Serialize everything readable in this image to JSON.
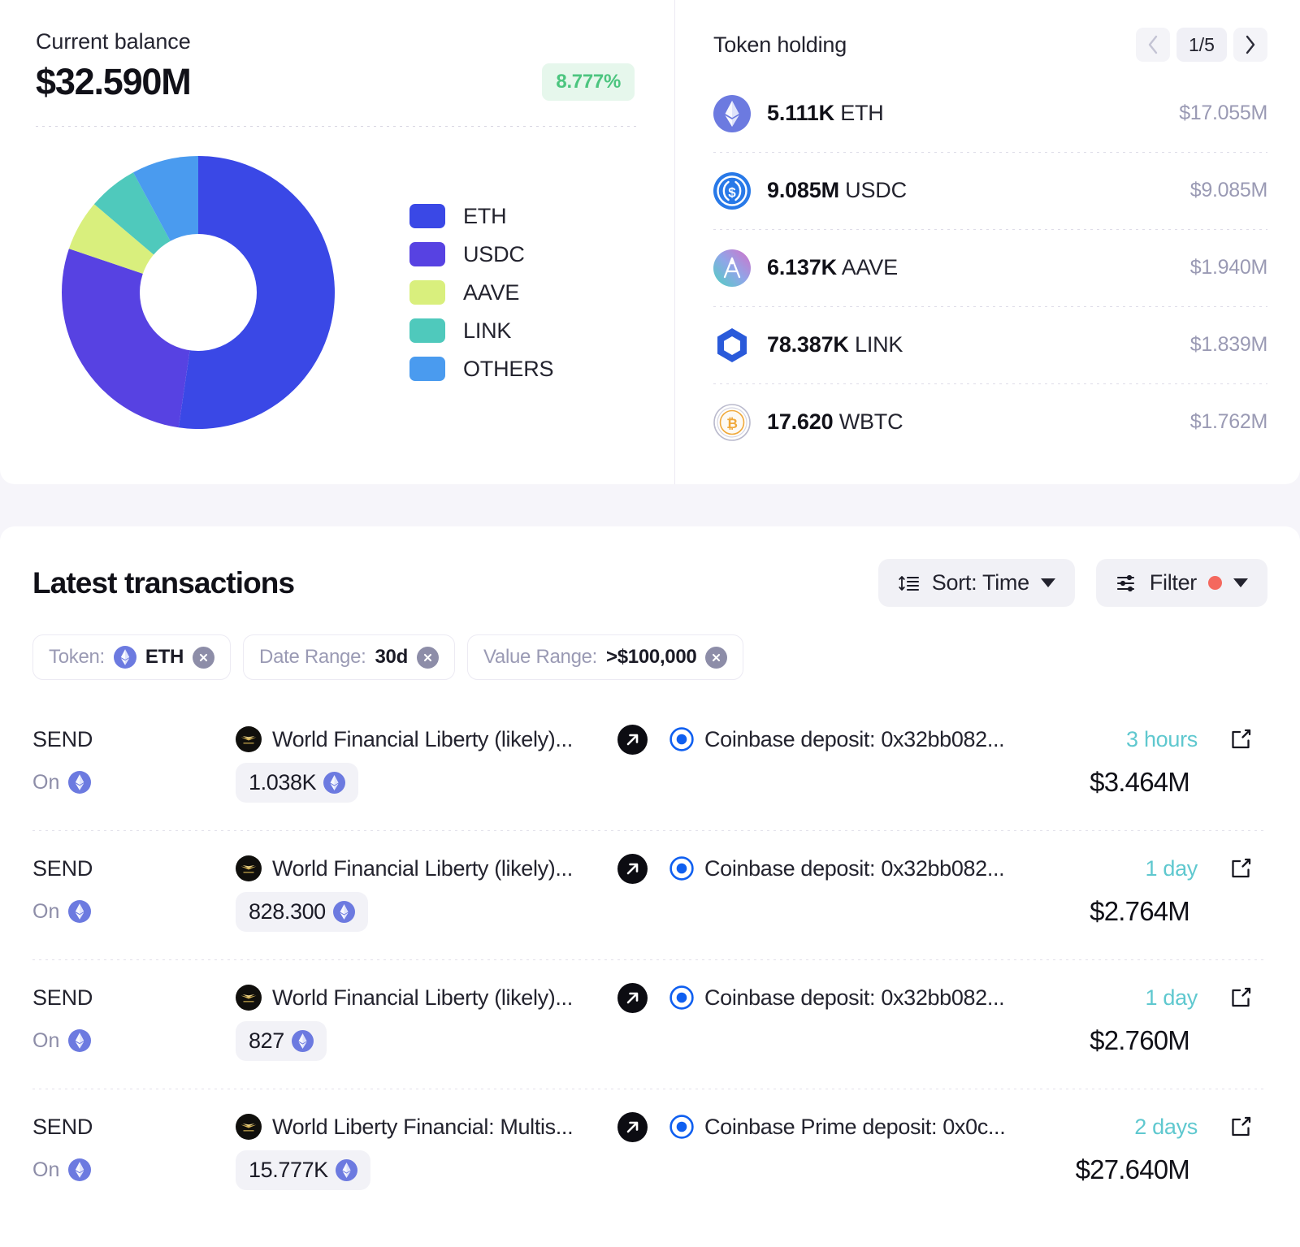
{
  "balance": {
    "label": "Current balance",
    "value": "$32.590M",
    "change": "8.777%",
    "change_color": "#4cc57f",
    "change_bg": "#e6f7ec"
  },
  "legend": [
    {
      "label": "ETH",
      "color": "#3a48e6"
    },
    {
      "label": "USDC",
      "color": "#5742e2"
    },
    {
      "label": "AAVE",
      "color": "#d9ef7d"
    },
    {
      "label": "LINK",
      "color": "#4fc9bc"
    },
    {
      "label": "OTHERS",
      "color": "#4a9bef"
    }
  ],
  "chart_data": {
    "type": "pie",
    "title": "Current balance allocation",
    "subtitle": "$32.590M",
    "variant": "donut",
    "categories": [
      "ETH",
      "USDC",
      "AAVE",
      "LINK",
      "OTHERS"
    ],
    "values": [
      52.3,
      27.9,
      6.0,
      5.9,
      7.9
    ],
    "unit": "percent",
    "colors": [
      "#3a48e6",
      "#5742e2",
      "#d9ef7d",
      "#4fc9bc",
      "#4a9bef"
    ],
    "legend_position": "right",
    "grid": false,
    "xlabel": "",
    "ylabel": ""
  },
  "token_holding": {
    "title": "Token holding",
    "page": "1/5",
    "prev_icon": "chevron-left-icon",
    "next_icon": "chevron-right-icon",
    "rows": [
      {
        "amount": "5.111K",
        "symbol": "ETH",
        "value": "$17.055M",
        "icon": "eth-token-icon"
      },
      {
        "amount": "9.085M",
        "symbol": "USDC",
        "value": "$9.085M",
        "icon": "usdc-token-icon"
      },
      {
        "amount": "6.137K",
        "symbol": "AAVE",
        "value": "$1.940M",
        "icon": "aave-token-icon"
      },
      {
        "amount": "78.387K",
        "symbol": "LINK",
        "value": "$1.839M",
        "icon": "link-token-icon"
      },
      {
        "amount": "17.620",
        "symbol": "WBTC",
        "value": "$1.762M",
        "icon": "wbtc-token-icon"
      }
    ]
  },
  "transactions": {
    "title": "Latest transactions",
    "sort_label": "Sort: Time",
    "filter_label": "Filter",
    "filter_dot_color": "#f4685e",
    "chips": [
      {
        "key": "Token:",
        "value": "ETH",
        "has_token_icon": true
      },
      {
        "key": "Date Range:",
        "value": "30d",
        "has_token_icon": false
      },
      {
        "key": "Value Range:",
        "value": ">$100,000",
        "has_token_icon": false
      }
    ],
    "rows": [
      {
        "type": "SEND",
        "on_label": "On",
        "from": "World Financial Liberty (likely)...",
        "to": "Coinbase deposit: 0x32bb082...",
        "amount": "1.038K",
        "time": "3 hours",
        "usd": "$3.464M"
      },
      {
        "type": "SEND",
        "on_label": "On",
        "from": "World Financial Liberty (likely)...",
        "to": "Coinbase deposit: 0x32bb082...",
        "amount": "828.300",
        "time": "1 day",
        "usd": "$2.764M"
      },
      {
        "type": "SEND",
        "on_label": "On",
        "from": "World Financial Liberty (likely)...",
        "to": "Coinbase deposit: 0x32bb082...",
        "amount": "827",
        "time": "1 day",
        "usd": "$2.760M"
      },
      {
        "type": "SEND",
        "on_label": "On",
        "from": "World Liberty Financial: Multis...",
        "to": "Coinbase Prime deposit: 0x0c...",
        "amount": "15.777K",
        "time": "2 days",
        "usd": "$27.640M"
      }
    ]
  }
}
